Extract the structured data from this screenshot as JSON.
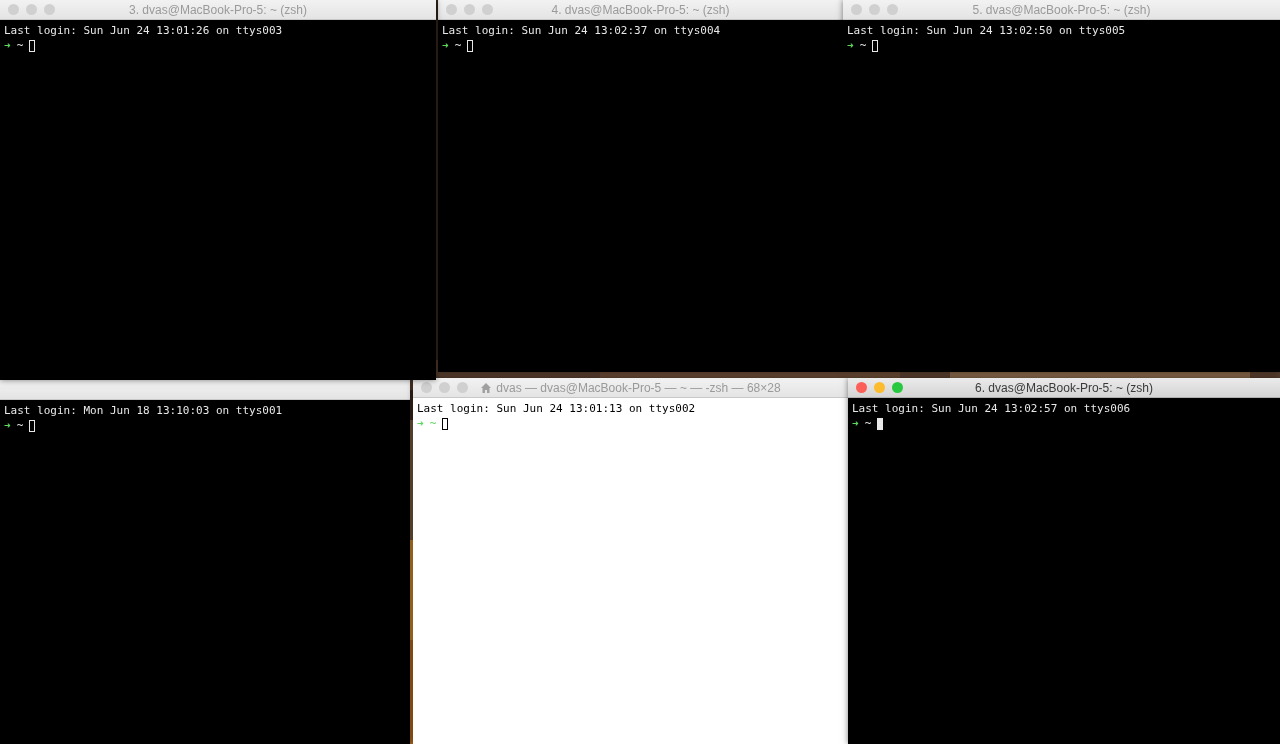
{
  "windows": [
    {
      "title": "3. dvas@MacBook-Pro-5: ~ (zsh)",
      "kind": "dark",
      "active": false,
      "buttons_visible": true,
      "last_login": "Last login: Sun Jun 24 13:01:26 on ttys003",
      "arrow": "➜",
      "prompt": "~",
      "cursor_filled": false,
      "home_icon": false
    },
    {
      "title": "4. dvas@MacBook-Pro-5: ~ (zsh)",
      "kind": "dark",
      "active": false,
      "buttons_visible": true,
      "last_login": "Last login: Sun Jun 24 13:02:37 on ttys004",
      "arrow": "➜",
      "prompt": "~",
      "cursor_filled": false,
      "home_icon": false
    },
    {
      "title": "5. dvas@MacBook-Pro-5: ~ (zsh)",
      "kind": "dark",
      "active": false,
      "buttons_visible": true,
      "last_login": "Last login: Sun Jun 24 13:02:50 on ttys005",
      "arrow": "➜",
      "prompt": "~",
      "cursor_filled": false,
      "home_icon": false
    },
    {
      "kind": "dark",
      "active": false,
      "buttons_visible": false,
      "last_login": "Last login: Mon Jun 18 13:10:03 on ttys001",
      "arrow": "➜",
      "prompt": "~",
      "cursor_filled": false,
      "home_icon": false
    },
    {
      "title": "dvas — dvas@MacBook-Pro-5 — ~ — -zsh — 68×28",
      "kind": "light",
      "active": false,
      "buttons_visible": true,
      "last_login": "Last login: Sun Jun 24 13:01:13 on ttys002",
      "arrow": "➜",
      "prompt": "~",
      "cursor_filled": false,
      "home_icon": true
    },
    {
      "title": "6. dvas@MacBook-Pro-5: ~ (zsh)",
      "kind": "dark",
      "active": true,
      "buttons_visible": true,
      "last_login": "Last login: Sun Jun 24 13:02:57 on ttys006",
      "arrow": "➜",
      "prompt": "~",
      "cursor_filled": true,
      "home_icon": false
    }
  ]
}
